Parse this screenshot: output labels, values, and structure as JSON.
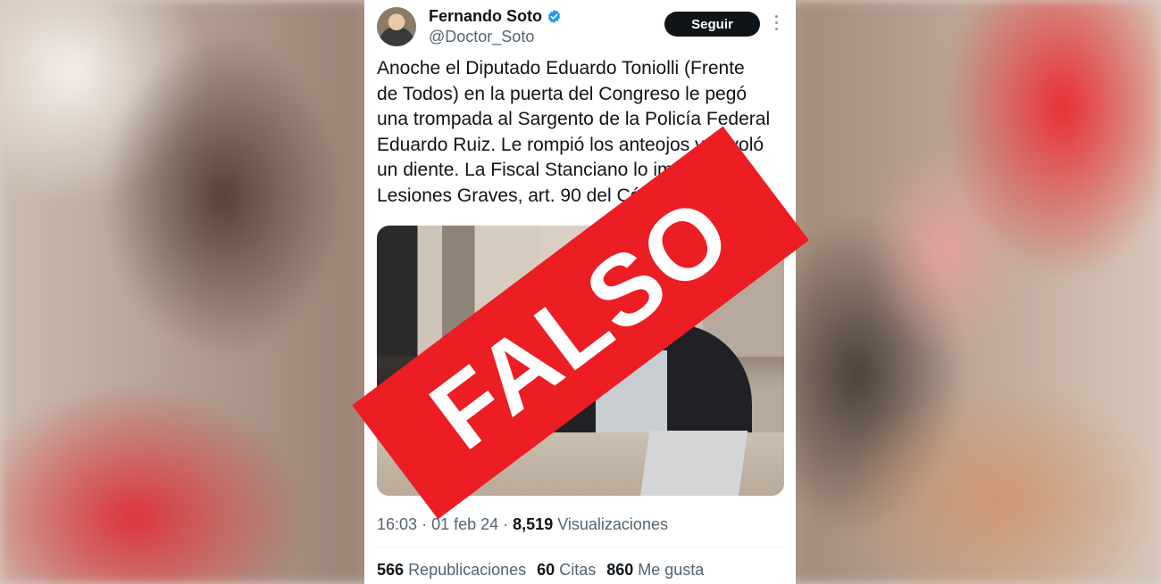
{
  "tweet": {
    "author_name": "Fernando Soto",
    "handle": "@Doctor_Soto",
    "follow_label": "Seguir",
    "text": "Anoche el Diputado Eduardo Toniolli (Frente\nde Todos) en la puerta del Congreso le pegó\nuna trompada al Sargento de la Policía Federal\nEduardo Ruiz. Le rompió los  anteojos y le voló\nun diente. La Fiscal Stanciano lo imputó por\nLesiones Graves, art. 90 del Código Penal.",
    "time": "16:03",
    "date": "01 feb 24",
    "views_count": "8,519",
    "views_label": "Visualizaciones",
    "reposts_count": "566",
    "reposts_label": "Republicaciones",
    "quotes_count": "60",
    "quotes_label": "Citas",
    "likes_count": "860",
    "likes_label": "Me gusta"
  },
  "overlay": {
    "label": "FALSO",
    "color": "#ed1d24"
  },
  "icons": {
    "verified": "verified-badge-icon",
    "more": "more-options-icon"
  },
  "colors": {
    "verified_blue": "#1d9bf0",
    "text_primary": "#0f1419",
    "text_secondary": "#536471"
  }
}
